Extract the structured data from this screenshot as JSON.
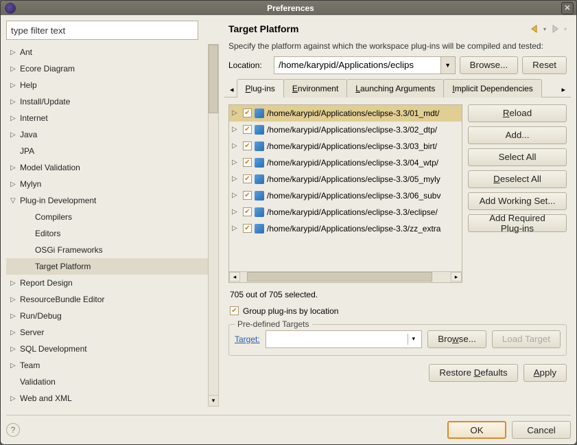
{
  "window": {
    "title": "Preferences"
  },
  "filter": {
    "placeholder": "type filter text"
  },
  "tree": {
    "items": [
      {
        "label": "Ant",
        "arrow": "▷"
      },
      {
        "label": "Ecore Diagram",
        "arrow": "▷"
      },
      {
        "label": "Help",
        "arrow": "▷"
      },
      {
        "label": "Install/Update",
        "arrow": "▷"
      },
      {
        "label": "Internet",
        "arrow": "▷"
      },
      {
        "label": "Java",
        "arrow": "▷"
      },
      {
        "label": "JPA",
        "arrow": ""
      },
      {
        "label": "Model Validation",
        "arrow": "▷"
      },
      {
        "label": "Mylyn",
        "arrow": "▷"
      },
      {
        "label": "Plug-in Development",
        "arrow": "▽",
        "expanded": true,
        "children": [
          {
            "label": "Compilers"
          },
          {
            "label": "Editors"
          },
          {
            "label": "OSGi Frameworks"
          },
          {
            "label": "Target Platform",
            "selected": true
          }
        ]
      },
      {
        "label": "Report Design",
        "arrow": "▷"
      },
      {
        "label": "ResourceBundle Editor",
        "arrow": "▷"
      },
      {
        "label": "Run/Debug",
        "arrow": "▷"
      },
      {
        "label": "Server",
        "arrow": "▷"
      },
      {
        "label": "SQL Development",
        "arrow": "▷"
      },
      {
        "label": "Team",
        "arrow": "▷"
      },
      {
        "label": "Validation",
        "arrow": ""
      },
      {
        "label": "Web and XML",
        "arrow": "▷"
      }
    ]
  },
  "panel": {
    "title": "Target Platform",
    "desc": "Specify the platform against which the workspace plug-ins will be compiled and tested:",
    "location_label": "Location:",
    "location_value": "/home/karypid/Applications/eclips",
    "browse": "Browse...",
    "reset": "Reset"
  },
  "tabs": {
    "items": [
      "Plug-ins",
      "Environment",
      "Launching Arguments",
      "Implicit Dependencies"
    ],
    "active": 0
  },
  "plugins": {
    "rows": [
      {
        "path": "/home/karypid/Applications/eclipse-3.3/01_mdt/",
        "hl": true
      },
      {
        "path": "/home/karypid/Applications/eclipse-3.3/02_dtp/"
      },
      {
        "path": "/home/karypid/Applications/eclipse-3.3/03_birt/"
      },
      {
        "path": "/home/karypid/Applications/eclipse-3.3/04_wtp/"
      },
      {
        "path": "/home/karypid/Applications/eclipse-3.3/05_myly"
      },
      {
        "path": "/home/karypid/Applications/eclipse-3.3/06_subv"
      },
      {
        "path": "/home/karypid/Applications/eclipse-3.3/eclipse/"
      },
      {
        "path": "/home/karypid/Applications/eclipse-3.3/zz_extra"
      }
    ],
    "status": "705 out of 705 selected.",
    "group_label": "Group plug-ins by location"
  },
  "side": {
    "reload": "Reload",
    "add": "Add...",
    "select_all": "Select All",
    "deselect_all": "Deselect All",
    "add_ws": "Add Working Set...",
    "add_req": "Add Required Plug-ins"
  },
  "predef": {
    "legend": "Pre-defined Targets",
    "target_label": "Target:",
    "browse": "Browse...",
    "load": "Load Target"
  },
  "buttons": {
    "restore": "Restore Defaults",
    "apply": "Apply",
    "ok": "OK",
    "cancel": "Cancel"
  }
}
